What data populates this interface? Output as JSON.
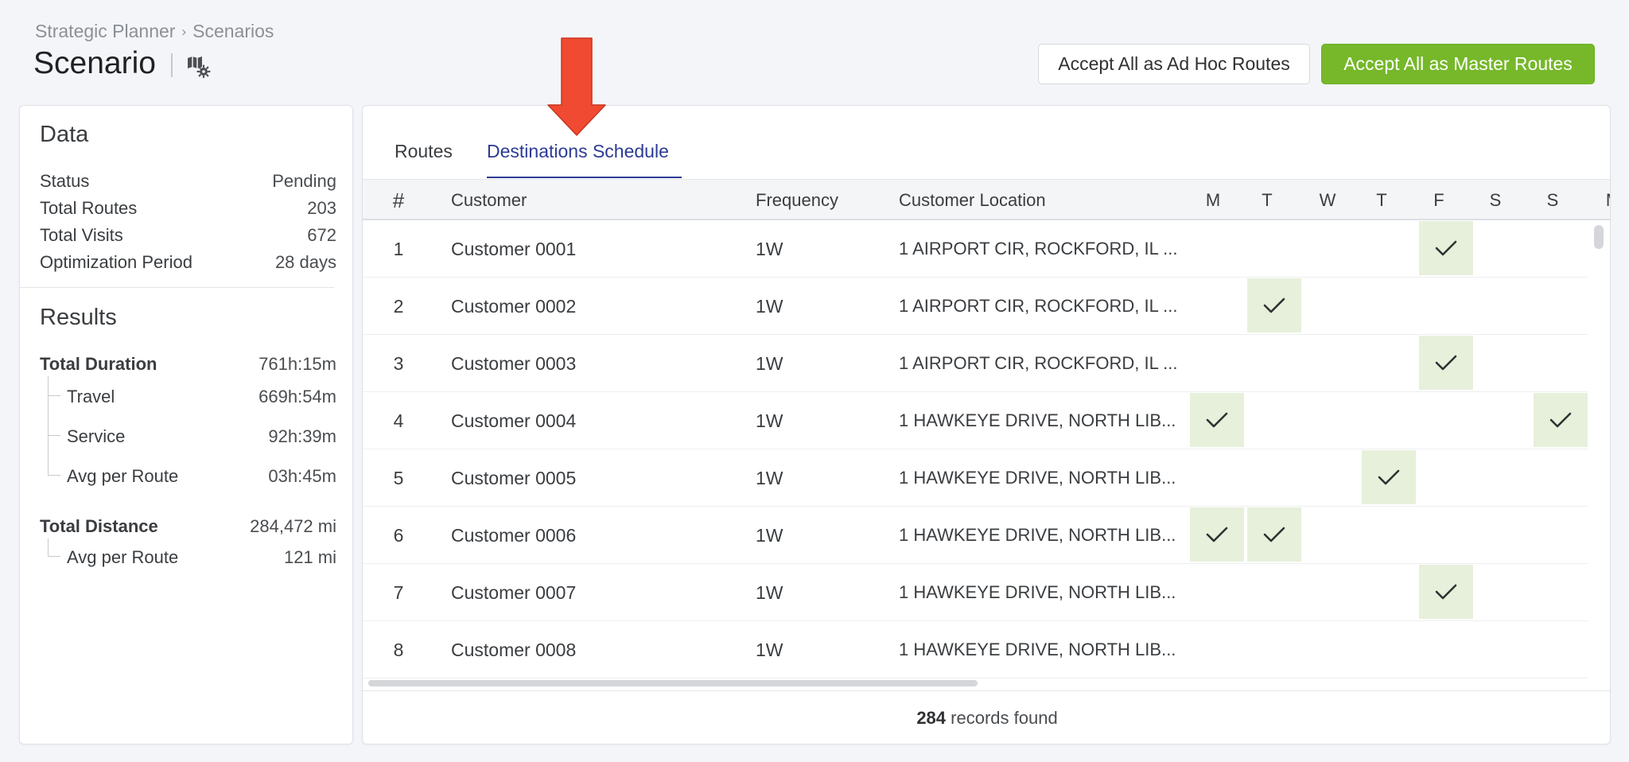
{
  "breadcrumb": {
    "root": "Strategic Planner",
    "separator": "›",
    "current": "Scenarios"
  },
  "page": {
    "title": "Scenario"
  },
  "icons": {
    "map_settings": "map-settings-icon",
    "check": "check-icon",
    "annotation": "red-arrow-icon"
  },
  "colors": {
    "accent": "#2c3b94",
    "primary_button": "#76b82a",
    "check_bg": "#e7f0db",
    "arrow": "#f04a32"
  },
  "actions": {
    "adhoc_label": "Accept All as Ad Hoc Routes",
    "master_label": "Accept All as Master Routes"
  },
  "data_panel": {
    "title": "Data",
    "rows": [
      {
        "label": "Status",
        "value": "Pending"
      },
      {
        "label": "Total Routes",
        "value": "203"
      },
      {
        "label": "Total Visits",
        "value": "672"
      },
      {
        "label": "Optimization Period",
        "value": "28 days"
      }
    ]
  },
  "results_panel": {
    "title": "Results",
    "total_duration": {
      "label": "Total Duration",
      "value": "761h:15m"
    },
    "travel": {
      "label": "Travel",
      "value": "669h:54m"
    },
    "service": {
      "label": "Service",
      "value": "92h:39m"
    },
    "avg_duration": {
      "label": "Avg per Route",
      "value": "03h:45m"
    },
    "total_distance": {
      "label": "Total Distance",
      "value": "284,472 mi"
    },
    "avg_distance": {
      "label": "Avg per Route",
      "value": "121 mi"
    }
  },
  "tabs": [
    {
      "label": "Routes",
      "active": false
    },
    {
      "label": "Destinations Schedule",
      "active": true
    }
  ],
  "table": {
    "headers": {
      "num": "#",
      "customer": "Customer",
      "frequency": "Frequency",
      "location": "Customer Location"
    },
    "days": [
      "M",
      "T",
      "W",
      "T",
      "F",
      "S",
      "S",
      "M"
    ],
    "rows": [
      {
        "num": "1",
        "customer": "Customer 0001",
        "frequency": "1W",
        "location": "1 AIRPORT CIR, ROCKFORD, IL ...",
        "checked": [
          4
        ]
      },
      {
        "num": "2",
        "customer": "Customer 0002",
        "frequency": "1W",
        "location": "1 AIRPORT CIR, ROCKFORD, IL ...",
        "checked": [
          1
        ]
      },
      {
        "num": "3",
        "customer": "Customer 0003",
        "frequency": "1W",
        "location": "1 AIRPORT CIR, ROCKFORD, IL ...",
        "checked": [
          4
        ]
      },
      {
        "num": "4",
        "customer": "Customer 0004",
        "frequency": "1W",
        "location": "1 HAWKEYE DRIVE, NORTH LIB...",
        "checked": [
          0,
          6
        ]
      },
      {
        "num": "5",
        "customer": "Customer 0005",
        "frequency": "1W",
        "location": "1 HAWKEYE DRIVE, NORTH LIB...",
        "checked": [
          3
        ]
      },
      {
        "num": "6",
        "customer": "Customer 0006",
        "frequency": "1W",
        "location": "1 HAWKEYE DRIVE, NORTH LIB...",
        "checked": [
          0,
          1
        ]
      },
      {
        "num": "7",
        "customer": "Customer 0007",
        "frequency": "1W",
        "location": "1 HAWKEYE DRIVE, NORTH LIB...",
        "checked": [
          4
        ]
      },
      {
        "num": "8",
        "customer": "Customer 0008",
        "frequency": "1W",
        "location": "1 HAWKEYE DRIVE, NORTH LIB...",
        "checked": []
      }
    ]
  },
  "footer": {
    "count": "284",
    "label": "records found"
  }
}
